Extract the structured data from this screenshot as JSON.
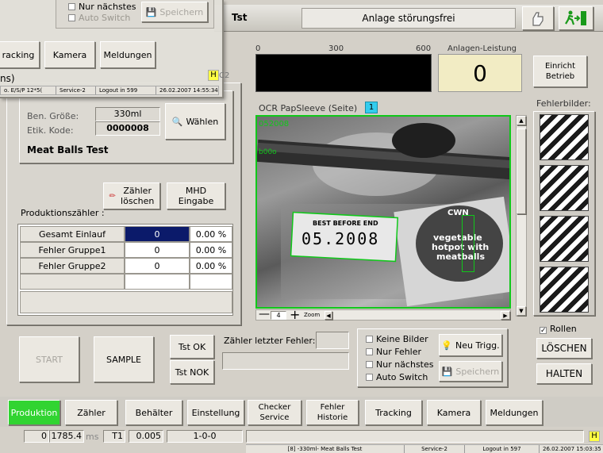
{
  "header": {
    "title": "Tst",
    "status": "Anlage störungsfrei",
    "help_icon": "hand-pointer-icon",
    "exit_icon": "exit-runner-icon"
  },
  "scale": {
    "labels": [
      "0",
      "300",
      "600"
    ],
    "performance_label": "Anlagen-Leistung",
    "performance_value": "0"
  },
  "einricht_button": "Einricht\nBetrieb",
  "fehlerbilder_label": "Fehlerbilder:",
  "camera": {
    "title": "OCR PapSleeve (Seite)",
    "badge": "1",
    "overlay_top": "052008",
    "overlay_side": "b00o",
    "stamp_line1": "BEST BEFORE END",
    "stamp_line2": "05.2008",
    "label_line1": "vegetable",
    "label_line2": "hotpot with",
    "label_line3": "meatballs",
    "label_brand": "CWN",
    "zoom_value": "4",
    "zoom_label": "Zoom"
  },
  "product": {
    "size_label": "Ben. Größe:",
    "size_value": "330ml",
    "code_label": "Etik. Kode:",
    "code_value": "0000008",
    "name": "Meat Balls Test",
    "choose_button": "Wählen"
  },
  "counter_buttons": {
    "reset": "Zähler\nlöschen",
    "mhd": "MHD\nEingabe"
  },
  "produktionszaehler_label": "Produktionszähler :",
  "counter_table": [
    {
      "name": "Gesamt Einlauf",
      "count": "0",
      "percent": "0.00 %"
    },
    {
      "name": "Fehler Gruppe1",
      "count": "0",
      "percent": "0.00 %"
    },
    {
      "name": "Fehler Gruppe2",
      "count": "0",
      "percent": "0.00 %"
    }
  ],
  "controls": {
    "start": "START",
    "sample": "SAMPLE",
    "tst_ok": "Tst OK",
    "tst_nok": "Tst NOK",
    "last_error_label": "Zähler letzter Fehler:"
  },
  "options": {
    "keine_bilder": "Keine Bilder",
    "nur_fehler": "Nur Fehler",
    "nur_naechstes": "Nur nächstes",
    "auto_switch": "Auto Switch",
    "neu_trigg": "Neu Trigg.",
    "speichern": "Speichern"
  },
  "right_panel": {
    "rollen": "Rollen",
    "loeschen": "LÖSCHEN",
    "halten": "HALTEN"
  },
  "tabs": [
    "Produktion",
    "Zähler",
    "Behälter",
    "Einstellung",
    "Checker\nService",
    "Fehler\nHistorie",
    "Tracking",
    "Kamera",
    "Meldungen"
  ],
  "status_bar": {
    "v1": "0",
    "v2": "1785.4",
    "unit": "ms",
    "t": "T1",
    "v3": "0.005",
    "v4": "1-0-0",
    "h": "H",
    "line": {
      "product": "[8] -330ml- Meat Balls Test",
      "service": "Service-2",
      "logout": "Logout in 597",
      "datetime": "26.02.2007 15:03:35"
    }
  },
  "ghost": {
    "nur_naechstes": "Nur nächstes",
    "auto_switch": "Auto Switch",
    "speichern": "Speichern",
    "tabs": [
      "racking",
      "Kamera",
      "Meldungen"
    ],
    "line1": "ns)",
    "status": {
      "a": "o. E/S/P 12*5(",
      "b": "Service-2",
      "c": "Logout in 599",
      "d": "26.02.2007 14:55:34",
      "h": "H",
      "c2": "C2"
    }
  },
  "colors": {
    "green_border": "#10c81a",
    "green_button": "#31d431",
    "selected_cell": "#0b1a6a",
    "badge": "#33ccee",
    "highlight_yellow": "#ffff44"
  }
}
